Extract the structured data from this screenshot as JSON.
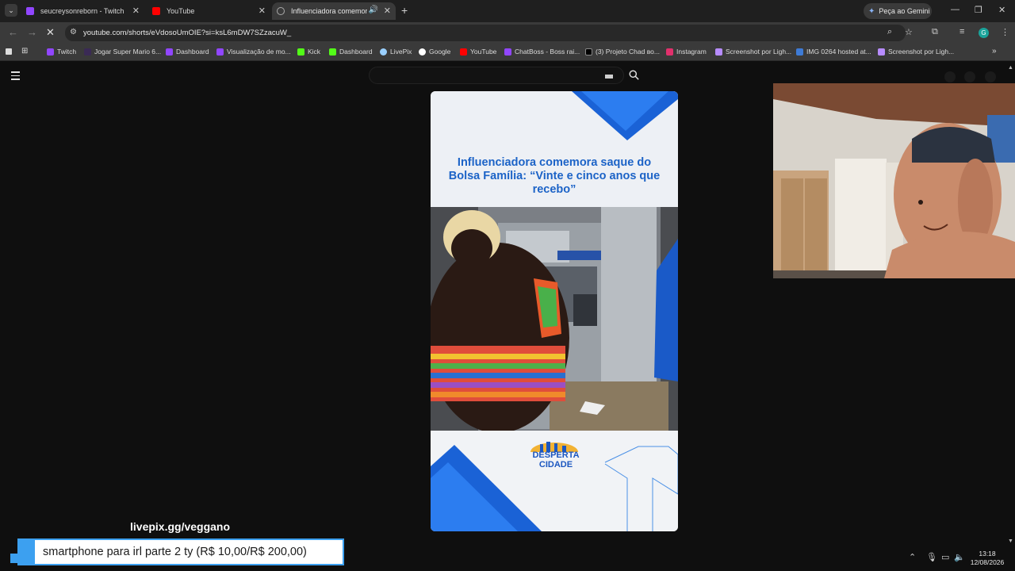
{
  "tabs": [
    {
      "title": "seucreysonreborn - Twitch",
      "color": "#9146ff"
    },
    {
      "title": "YouTube",
      "color": "#ff0000"
    },
    {
      "title": "Influenciadora comemora s",
      "color": "#aaaaaa"
    }
  ],
  "gemini_label": "Peça ao Gemini",
  "url": "youtube.com/shorts/eVdosoUmOIE?si=ksL6mDW7SZzacuW_",
  "profile_initial": "G",
  "bookmarks": [
    {
      "label": "Twitch",
      "color": "#9146ff"
    },
    {
      "label": "Jogar Super Mario 6...",
      "color": "#3a2a55"
    },
    {
      "label": "Dashboard",
      "color": "#9146ff"
    },
    {
      "label": "Visualização de mo...",
      "color": "#9146ff"
    },
    {
      "label": "Kick",
      "color": "#53fc18"
    },
    {
      "label": "Dashboard",
      "color": "#53fc18"
    },
    {
      "label": "LivePix",
      "color": "#9ad0ff"
    },
    {
      "label": "Google",
      "color": "#ffffff"
    },
    {
      "label": "YouTube",
      "color": "#ff0000"
    },
    {
      "label": "ChatBoss - Boss rai...",
      "color": "#9146ff"
    },
    {
      "label": "(3) Projeto Chad во...",
      "color": "#000000"
    },
    {
      "label": "Instagram",
      "color": "#e1306c"
    },
    {
      "label": "Screenshot por Ligh...",
      "color": "#b78cff"
    },
    {
      "label": "IMG 0264 hosted at...",
      "color": "#3e7bd6"
    },
    {
      "label": "Screenshot por Ligh...",
      "color": "#b78cff"
    }
  ],
  "short": {
    "headline": "Influenciadora comemora saque do Bolsa Família: “Vinte e cinco anos que recebo”",
    "brand_line1": "DESPERTA",
    "brand_line2": "CIDADE"
  },
  "stream": {
    "donation_link": "livepix.gg/veggano",
    "goal_text": "smartphone para irl parte 2 ty (R$ 10,00/R$ 200,00)"
  },
  "clock": {
    "time": "13:18",
    "date": "12/08/2026"
  },
  "accent": "#3ca0f0"
}
